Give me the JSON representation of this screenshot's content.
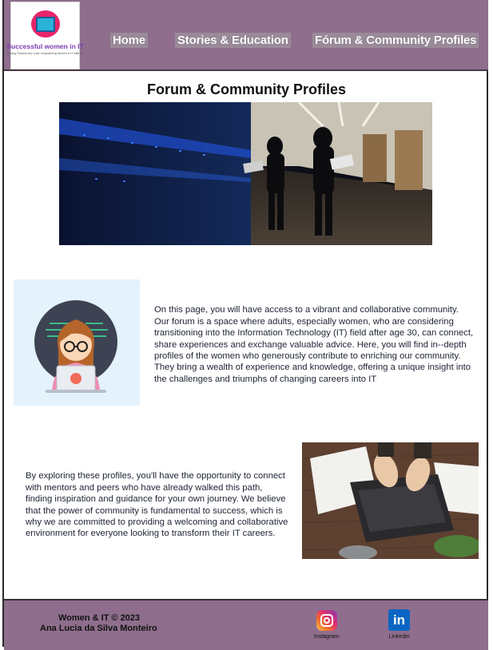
{
  "logo": {
    "title": "Successful women in IT",
    "tagline": "Turning Dreams into Code: Empowering Women in IT After 30"
  },
  "nav": {
    "home": "Home",
    "stories": "Stories & Education",
    "forum": "Fórum & Community Profiles"
  },
  "main": {
    "title": "Forum & Community Profiles",
    "paragraph1": "On this page, you will have access to a vibrant and collaborative community. Our forum is a space where adults, especially women, who are considering transitioning into the Information Technology (IT) field after age 30, can connect, share experiences and exchange valuable advice. Here, you will find in--depth profiles of the women who generously contribute to enriching our community. They bring a wealth of experience and knowledge, offering a unique insight into the challenges and triumphs of changing careers into IT",
    "paragraph2": "By exploring these profiles, you'll have the opportunity to connect with mentors and peers who have already walked this path, finding inspiration and guidance for your own journey. We believe that the power of community is fundamental to success, which is why we are committed to providing a welcoming and collaborative environment for everyone looking to transform their IT careers."
  },
  "footer": {
    "copyright": "Women & IT © 2023",
    "author": "Ana Lucia da Silva Monteiro",
    "instagram_label": "Instagram",
    "linkedin_label": "Linkedin",
    "linkedin_glyph": "in"
  },
  "colors": {
    "header_bg": "#8e6e8c",
    "footer_bg": "#8e6e8c",
    "avatar_bg": "#e3f2fb",
    "text": "#1d2333"
  },
  "icons": [
    "logo-image",
    "instagram-icon",
    "linkedin-icon"
  ]
}
